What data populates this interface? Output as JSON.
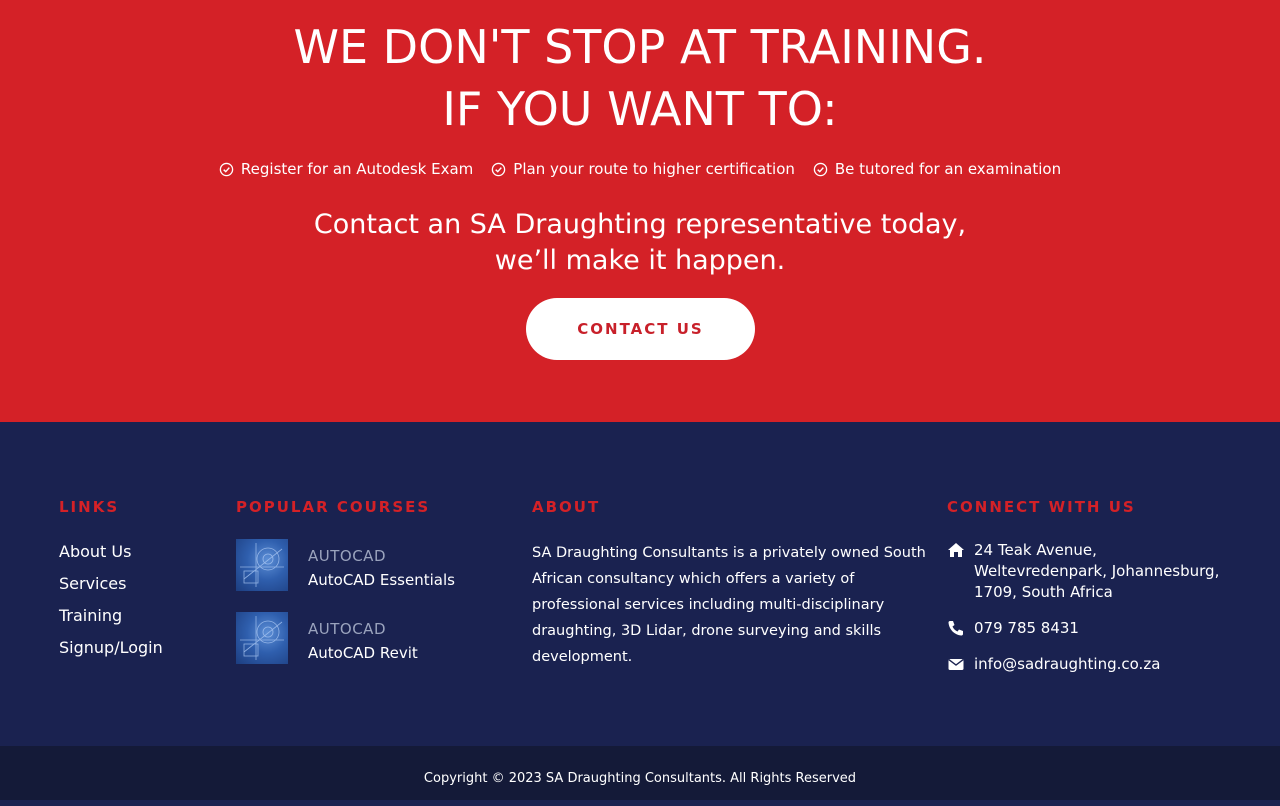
{
  "hero": {
    "title_line1": "WE DON'T STOP AT TRAINING.",
    "title_line2": "IF YOU WANT TO:",
    "checks": [
      "Register for an Autodesk Exam",
      "Plan your route to higher certification",
      "Be tutored for an examination"
    ],
    "contact_line1": "Contact an SA Draughting representative today,",
    "contact_line2": "we’ll make it happen.",
    "cta_label": "CONTACT US"
  },
  "footer": {
    "links_heading": "LINKS",
    "links": [
      "About Us",
      "Services",
      "Training",
      "Signup/Login"
    ],
    "courses_heading": "POPULAR COURSES",
    "courses": [
      {
        "category": "AUTOCAD",
        "name": "AutoCAD Essentials"
      },
      {
        "category": "AUTOCAD",
        "name": "AutoCAD Revit"
      }
    ],
    "about_heading": "ABOUT",
    "about_text": "SA Draughting Consultants is a privately owned South African consultancy which offers a variety of professional services including multi-disciplinary draughting, 3D Lidar, drone surveying and skills development.",
    "connect_heading": "CONNECT WITH US",
    "address_line1": "24 Teak Avenue,",
    "address_line2": "Weltevredenpark, Johannesburg,",
    "address_line3": "1709, South Africa",
    "phone": "079 785 8431",
    "email": "info@sadraughting.co.za"
  },
  "copyright": "Copyright © 2023 SA Draughting Consultants. All Rights Reserved",
  "icons": {
    "check": "check-circle-icon",
    "home": "home-icon",
    "phone": "phone-icon",
    "mail": "envelope-icon"
  },
  "colors": {
    "hero_bg": "#d42127",
    "footer_bg": "#1a2250",
    "bottom_bg": "#141a38",
    "accent": "#d42127",
    "muted": "#9aa3bd"
  }
}
